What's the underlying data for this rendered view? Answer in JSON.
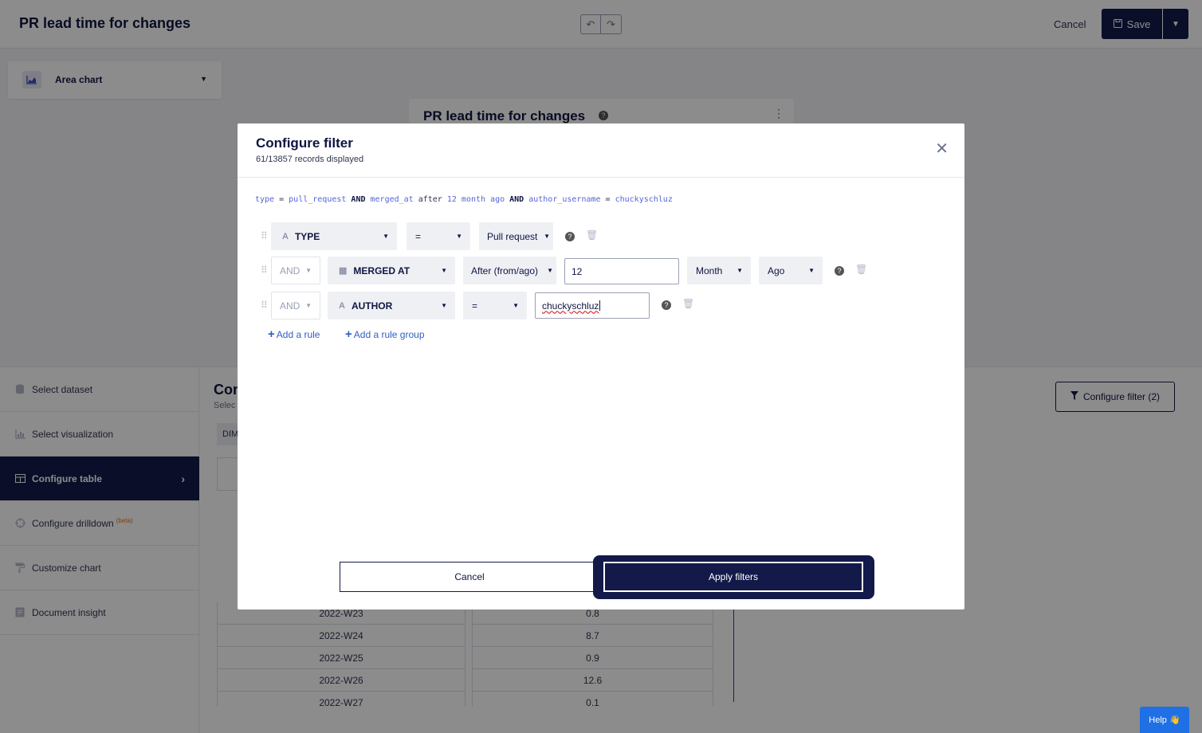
{
  "header": {
    "title": "PR lead time for changes",
    "cancel_label": "Cancel",
    "save_label": "Save"
  },
  "chart_type": {
    "label": "Area chart"
  },
  "chart_card": {
    "title": "PR lead time for changes"
  },
  "sidenav": {
    "items": [
      {
        "label": "Select dataset",
        "icon": "database-icon"
      },
      {
        "label": "Select visualization",
        "icon": "bar-chart-icon"
      },
      {
        "label": "Configure table",
        "icon": "table-icon",
        "active": true
      },
      {
        "label": "Configure drilldown",
        "icon": "crosshair-icon",
        "badge": "(beta)"
      },
      {
        "label": "Customize chart",
        "icon": "paint-roller-icon"
      },
      {
        "label": "Document insight",
        "icon": "document-icon"
      }
    ]
  },
  "workspace": {
    "heading": "Con",
    "sub": "Selec",
    "dim_tab": "DIM",
    "configure_filter_label": "Configure filter (2)"
  },
  "table": {
    "rows": [
      [
        "2022-W23",
        "0.8"
      ],
      [
        "2022-W24",
        "8.7"
      ],
      [
        "2022-W25",
        "0.9"
      ],
      [
        "2022-W26",
        "12.6"
      ],
      [
        "2022-W27",
        "0.1"
      ]
    ]
  },
  "modal": {
    "title": "Configure filter",
    "subtitle": "61/13857 records displayed",
    "query": {
      "t1": "type",
      "t2": " = ",
      "t3": "pull_request",
      "t4": " AND ",
      "t5": "merged_at",
      "t6": " after ",
      "t7": "12 month ago",
      "t8": " AND ",
      "t9": "author_username",
      "t10": " = ",
      "t11": "chuckyschluz"
    },
    "rules": {
      "r1": {
        "field": "TYPE",
        "operator": "=",
        "value": "Pull request"
      },
      "r2": {
        "conj": "AND",
        "field": "MERGED AT",
        "operator": "After (from/ago)",
        "amount": "12",
        "unit": "Month",
        "direction": "Ago"
      },
      "r3": {
        "conj": "AND",
        "field": "AUTHOR",
        "operator": "=",
        "value": "chuckyschluz"
      }
    },
    "add_rule": "Add a rule",
    "add_rule_group": "Add a rule group",
    "cancel_label": "Cancel",
    "apply_label": "Apply filters"
  },
  "help": {
    "label": "Help 👋"
  },
  "colors": {
    "primary": "#131a4a",
    "link": "#2f5fc2",
    "accent_blue": "#1f6fe5"
  }
}
